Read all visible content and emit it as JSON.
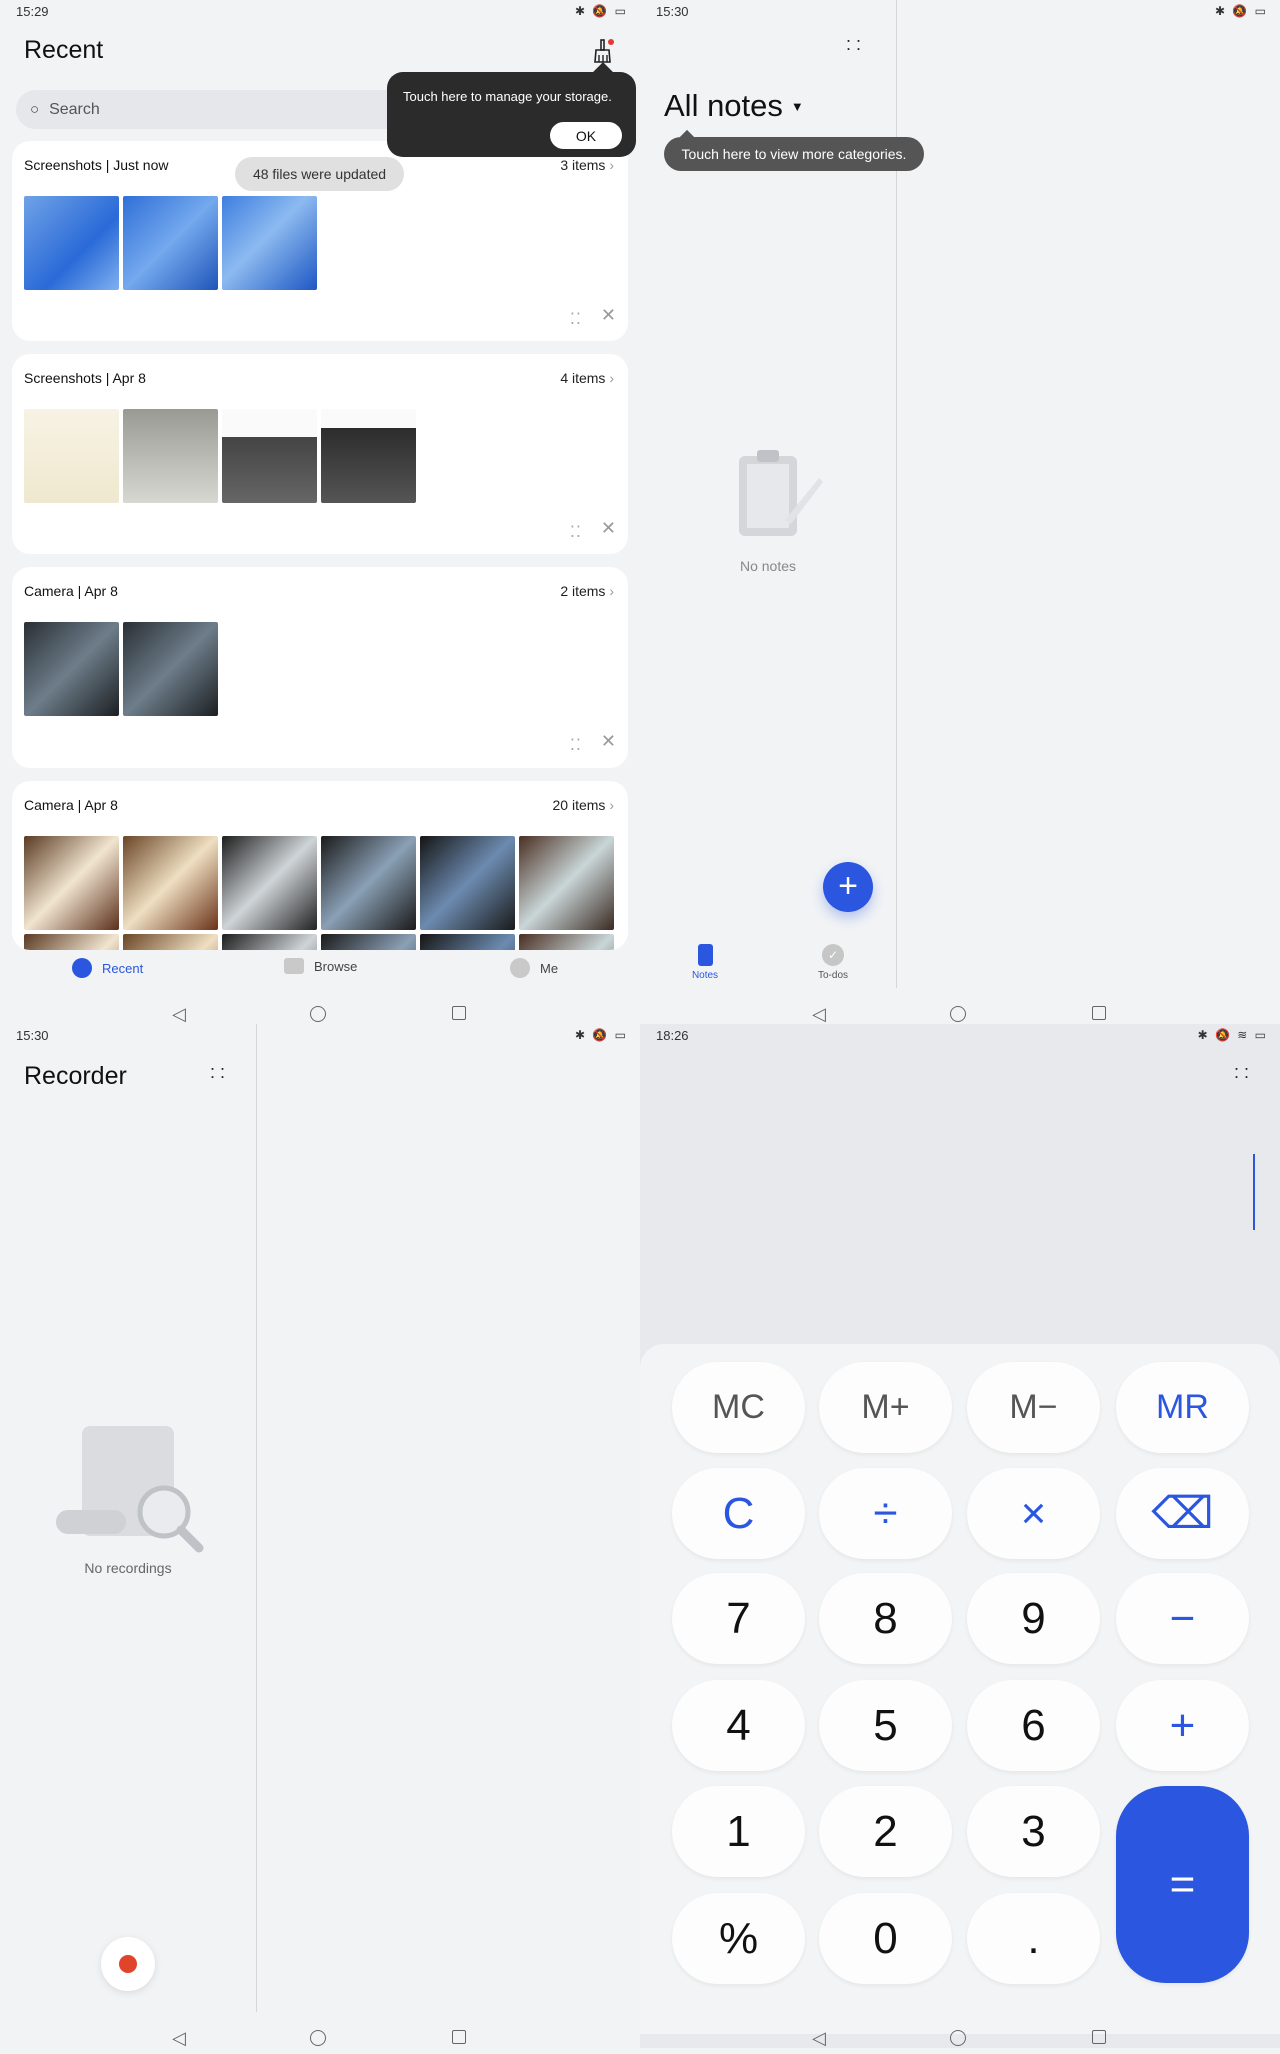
{
  "files": {
    "status": {
      "time": "15:29",
      "icons": "✱ 🔕 ▭"
    },
    "title": "Recent",
    "search_placeholder": "Search",
    "storage_tooltip": {
      "text": "Touch here to manage your storage.",
      "ok": "OK"
    },
    "toast": "48 files were updated",
    "cards": [
      {
        "title": "Screenshots | Just now",
        "count": "3 items",
        "thumbs": 3
      },
      {
        "title": "Screenshots | Apr 8",
        "count": "4 items",
        "thumbs": 4
      },
      {
        "title": "Camera | Apr 8",
        "count": "2 items",
        "thumbs": 2
      },
      {
        "title": "Camera | Apr 8",
        "count": "20 items",
        "thumbs": 12
      }
    ],
    "tabs": [
      {
        "label": "Recent",
        "active": true
      },
      {
        "label": "Browse"
      },
      {
        "label": "Me"
      }
    ]
  },
  "notes": {
    "status": {
      "time": "15:30",
      "icons": "✱ 🔕 ▭"
    },
    "title": "All notes",
    "tooltip": "Touch here to view more categories.",
    "empty": "No notes",
    "tabs": [
      {
        "label": "Notes",
        "active": true
      },
      {
        "label": "To-dos"
      }
    ]
  },
  "recorder": {
    "status": {
      "time": "15:30",
      "icons": "✱ 🔕 ▭"
    },
    "title": "Recorder",
    "empty": "No recordings"
  },
  "calculator": {
    "status": {
      "time": "18:26",
      "icons": "✱ 🔕 ≋ ▭"
    },
    "keys": [
      [
        "MC",
        "M+",
        "M−",
        "MR"
      ],
      [
        "C",
        "÷",
        "×",
        "⌫"
      ],
      [
        "7",
        "8",
        "9",
        "−"
      ],
      [
        "4",
        "5",
        "6",
        "+"
      ],
      [
        "1",
        "2",
        "3",
        "="
      ],
      [
        "%",
        "0",
        "."
      ]
    ]
  },
  "colors": {
    "accent": "#2a56e0",
    "record": "#e0442b",
    "tooltip": "#2b2b2b"
  }
}
